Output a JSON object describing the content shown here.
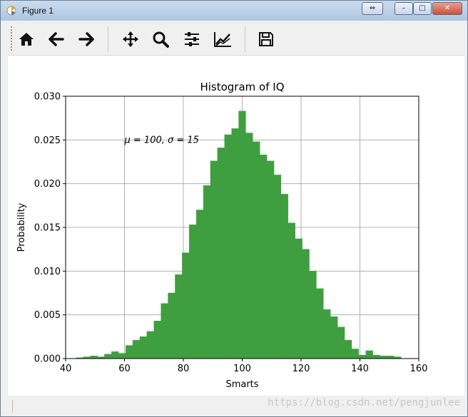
{
  "window": {
    "title": "Figure 1",
    "buttons": {
      "swap": "⇔",
      "minimize": "–",
      "maximize": "□",
      "close": "✕"
    }
  },
  "toolbar": {
    "icons": [
      "home-icon",
      "back-arrow-icon",
      "forward-arrow-icon",
      "pan-icon",
      "zoom-icon",
      "configure-subplots-icon",
      "edit-axis-icon",
      "save-icon"
    ]
  },
  "status": {
    "watermark": "https://blog.csdn.net/pengjunlee"
  },
  "chart_data": {
    "type": "bar",
    "title": "Histogram of IQ",
    "xlabel": "Smarts",
    "ylabel": "Probability",
    "annotation": "μ = 100,  σ = 15",
    "annotation_position": {
      "x": 60,
      "y": 0.025
    },
    "xlim": [
      40,
      160
    ],
    "ylim": [
      0,
      0.03
    ],
    "xticks": [
      "40",
      "60",
      "80",
      "100",
      "120",
      "140",
      "160"
    ],
    "yticks": [
      "0.000",
      "0.005",
      "0.010",
      "0.015",
      "0.020",
      "0.025",
      "0.030"
    ],
    "grid": true,
    "color": "#3f9e3f",
    "bin_edges_start": 43.6,
    "bin_width": 2.4,
    "values": [
      0.0001,
      0.0002,
      0.0003,
      0.0002,
      0.0005,
      0.0008,
      0.0006,
      0.0015,
      0.0021,
      0.0025,
      0.0031,
      0.0043,
      0.0063,
      0.0075,
      0.0096,
      0.0121,
      0.0153,
      0.017,
      0.0198,
      0.0226,
      0.0241,
      0.0256,
      0.0263,
      0.0283,
      0.0258,
      0.0248,
      0.0233,
      0.0226,
      0.021,
      0.0188,
      0.0155,
      0.0137,
      0.0125,
      0.01,
      0.008,
      0.0056,
      0.0048,
      0.0036,
      0.0021,
      0.0011,
      0.0004,
      0.0009,
      0.0004,
      0.0003,
      0.0003,
      0.0002
    ]
  }
}
